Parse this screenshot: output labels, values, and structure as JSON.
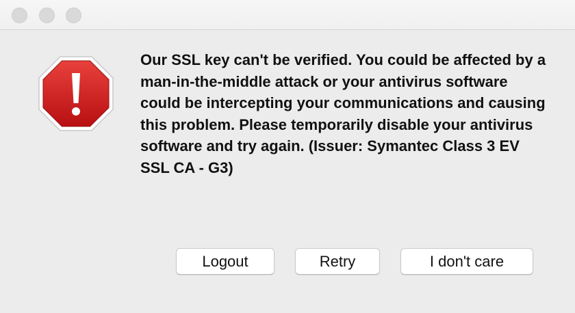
{
  "dialog": {
    "icon": "stop-sign-exclamation-icon",
    "message": "Our SSL key can't be verified. You could be affected by a man-in-the-middle attack or your antivirus software could be intercepting your communications and causing this problem. Please temporarily disable your antivirus software and try again. (Issuer: Symantec Class 3 EV SSL CA - G3)",
    "buttons": {
      "logout": "Logout",
      "retry": "Retry",
      "dont_care": "I don't care"
    }
  },
  "colors": {
    "background": "#ececec",
    "icon_red": "#d21e1e",
    "button_bg": "#ffffff"
  }
}
